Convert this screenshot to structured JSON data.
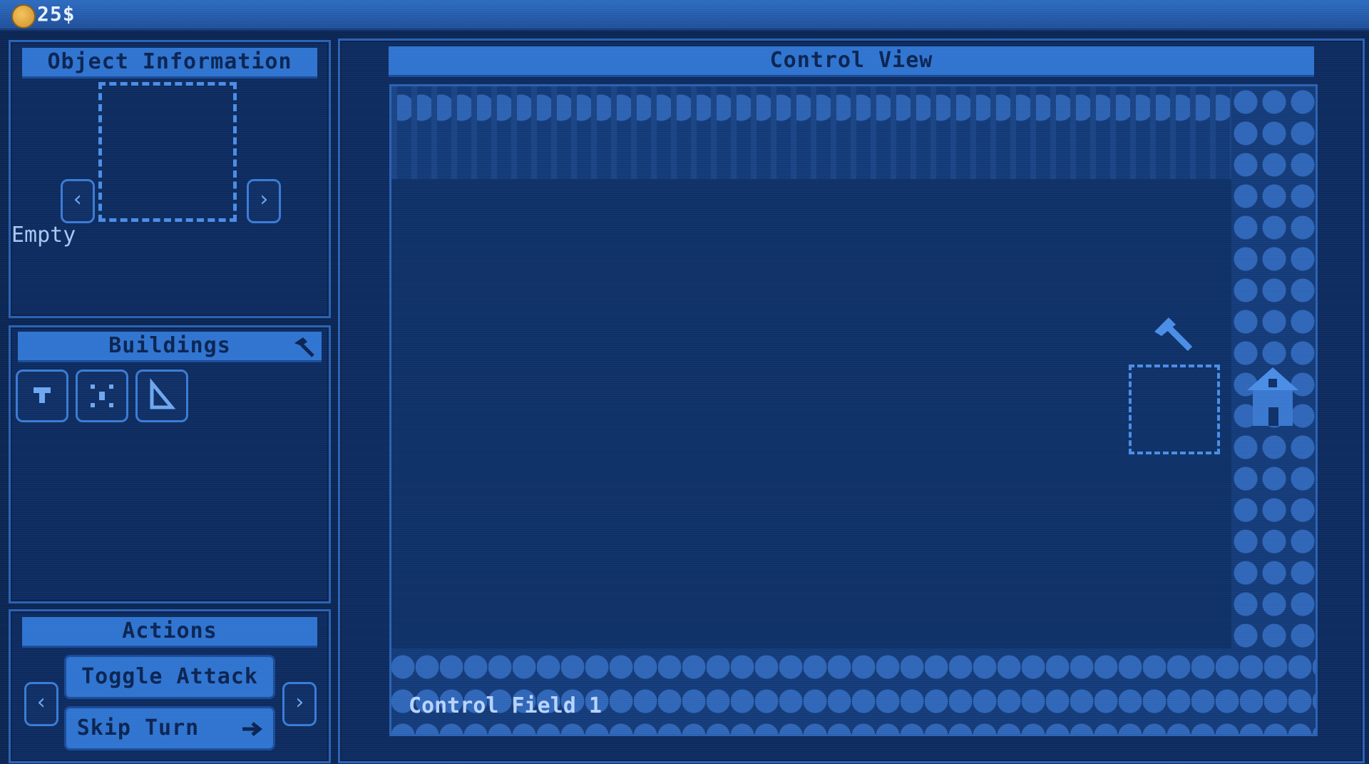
{
  "topbar": {
    "money": "25$",
    "coin_icon": "coin-icon"
  },
  "object_info": {
    "title": "Object Information",
    "status": "Empty",
    "prev": "‹",
    "next": "›"
  },
  "buildings": {
    "title": "Buildings",
    "items": [
      {
        "icon": "turret-icon"
      },
      {
        "icon": "crosshair-icon"
      },
      {
        "icon": "ruler-icon"
      }
    ]
  },
  "actions": {
    "title": "Actions",
    "prev": "‹",
    "next": "›",
    "toggle_attack": "Toggle Attack",
    "skip_turn": "Skip Turn"
  },
  "control_view": {
    "title": "Control View",
    "field_label": "Control Field 1"
  },
  "colors": {
    "background": "#0b2654",
    "panel": "#0d2b5f",
    "accent": "#2f74d0",
    "coin": "#f5c35b"
  }
}
